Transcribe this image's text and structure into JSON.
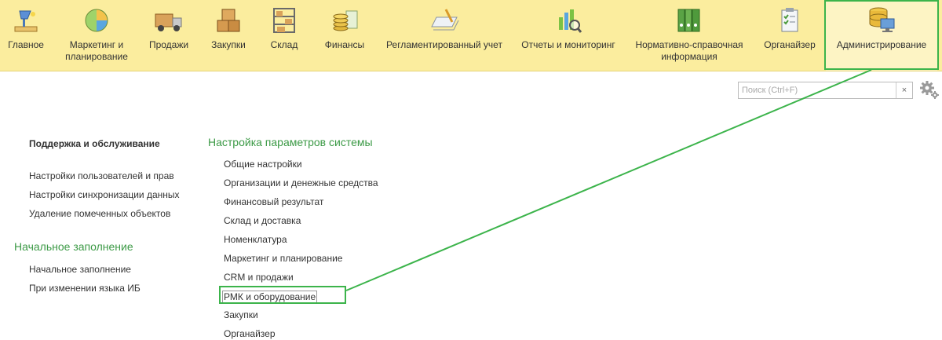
{
  "tabs": [
    {
      "label": "Главное",
      "icon": "desk-lamp-icon"
    },
    {
      "label": "Маркетинг и\nпланирование",
      "icon": "pie-chart-icon"
    },
    {
      "label": "Продажи",
      "icon": "delivery-truck-icon"
    },
    {
      "label": "Закупки",
      "icon": "boxes-icon"
    },
    {
      "label": "Склад",
      "icon": "warehouse-shelf-icon"
    },
    {
      "label": "Финансы",
      "icon": "coins-icon"
    },
    {
      "label": "Регламентированный учет",
      "icon": "document-pen-icon"
    },
    {
      "label": "Отчеты и мониторинг",
      "icon": "bar-chart-magnifier-icon"
    },
    {
      "label": "Нормативно-справочная\nинформация",
      "icon": "binders-icon"
    },
    {
      "label": "Органайзер",
      "icon": "clipboard-checklist-icon"
    },
    {
      "label": "Администрирование",
      "icon": "database-computer-icon"
    }
  ],
  "search": {
    "placeholder": "Поиск (Ctrl+F)",
    "clear": "×"
  },
  "left": {
    "support_heading": "Поддержка и обслуживание",
    "support_links": [
      "Настройки пользователей и прав",
      "Настройки синхронизации данных",
      "Удаление помеченных объектов"
    ],
    "initial_heading": "Начальное заполнение",
    "initial_links": [
      "Начальное заполнение",
      "При изменении языка ИБ"
    ]
  },
  "main": {
    "heading": "Настройка параметров системы",
    "links": [
      "Общие настройки",
      "Организации и денежные средства",
      "Финансовый результат",
      "Склад и доставка",
      "Номенклатура",
      "Маркетинг и планирование",
      "CRM и продажи",
      "РМК и оборудование",
      "Закупки",
      "Органайзер"
    ]
  },
  "colors": {
    "accent_green": "#3cb44b",
    "heading_green": "#3c9a46",
    "topbar": "#fbed9e"
  }
}
